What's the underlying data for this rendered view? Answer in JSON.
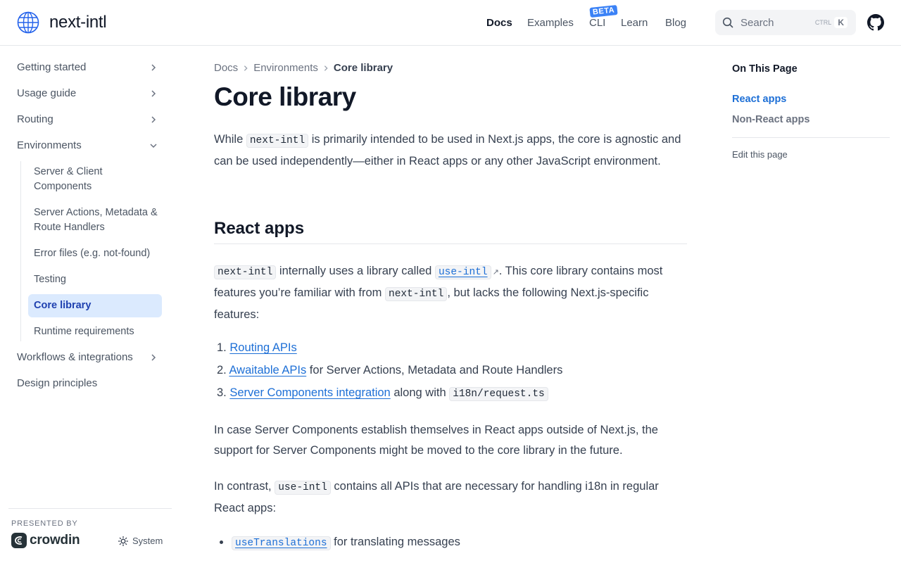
{
  "header": {
    "logo_text": "next-intl",
    "nav": {
      "docs": "Docs",
      "examples": "Examples",
      "cli": "CLI",
      "cli_badge": "BETA",
      "learn": "Learn",
      "blog": "Blog"
    },
    "search": {
      "placeholder": "Search",
      "kbd_ctrl": "CTRL",
      "kbd_key": "K"
    }
  },
  "sidebar": {
    "items": [
      {
        "label": "Getting started"
      },
      {
        "label": "Usage guide"
      },
      {
        "label": "Routing"
      },
      {
        "label": "Environments"
      }
    ],
    "sub_items": [
      {
        "label": "Server & Client Components"
      },
      {
        "label": "Server Actions, Metadata & Route Handlers"
      },
      {
        "label": "Error files (e.g. not-found)"
      },
      {
        "label": "Testing"
      },
      {
        "label": "Core library"
      },
      {
        "label": "Runtime requirements"
      }
    ],
    "bottom_items": [
      {
        "label": "Workflows & integrations"
      },
      {
        "label": "Design principles"
      }
    ],
    "presented_by": "PRESENTED BY",
    "sponsor": "crowdin",
    "theme": "System"
  },
  "main": {
    "breadcrumb": [
      "Docs",
      "Environments",
      "Core library"
    ],
    "title": "Core library",
    "intro": {
      "t1": "While ",
      "code1": "next-intl",
      "t2": " is primarily intended to be used in Next.js apps, the core is agnostic and can be used independently—either in React apps or any other JavaScript environment."
    },
    "section_title": "React apps",
    "para1": {
      "code1": "next-intl",
      "t1": " internally uses a library called ",
      "link_code": "use-intl",
      "ext": "↗",
      "t2": ". This core library contains most features you’re familiar with from ",
      "code2": "next-intl",
      "t3": ", but lacks the following Next.js-specific features:"
    },
    "list": [
      {
        "num": "1.",
        "link": "Routing APIs",
        "rest": ""
      },
      {
        "num": "2.",
        "link": "Awaitable APIs",
        "rest": " for Server Actions, Metadata and Route Handlers"
      },
      {
        "num": "3.",
        "link": "Server Components integration",
        "rest": " along with ",
        "code": "i18n/request.ts"
      }
    ],
    "para2": "In case Server Components establish themselves in React apps outside of Next.js, the support for Server Components might be moved to the core library in the future.",
    "para3": {
      "t1": "In contrast, ",
      "code1": "use-intl",
      "t2": " contains all APIs that are necessary for handling i18n in regular React apps:"
    },
    "bullets": [
      {
        "link_code": "useTranslations",
        "rest": " for translating messages"
      }
    ]
  },
  "toc": {
    "title": "On This Page",
    "items": [
      "React apps",
      "Non-React apps"
    ],
    "edit": "Edit this page"
  }
}
